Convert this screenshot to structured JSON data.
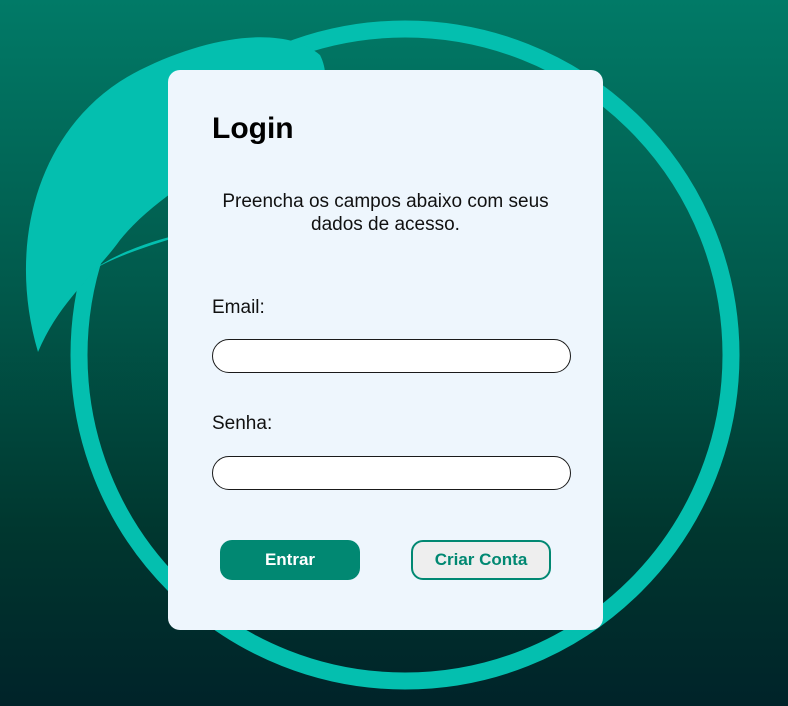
{
  "login": {
    "title": "Login",
    "subtitle": "Preencha os campos abaixo com seus dados de acesso.",
    "email_label": "Email:",
    "email_value": "",
    "password_label": "Senha:",
    "password_value": "",
    "submit_label": "Entrar",
    "create_account_label": "Criar Conta"
  },
  "colors": {
    "background_top": "#017a67",
    "background_bottom": "#002329",
    "card": "#eef6fd",
    "accent": "#018872",
    "decoration": "#04bfaf"
  },
  "icons": {
    "background_decoration": "leaf-ring-shape"
  }
}
